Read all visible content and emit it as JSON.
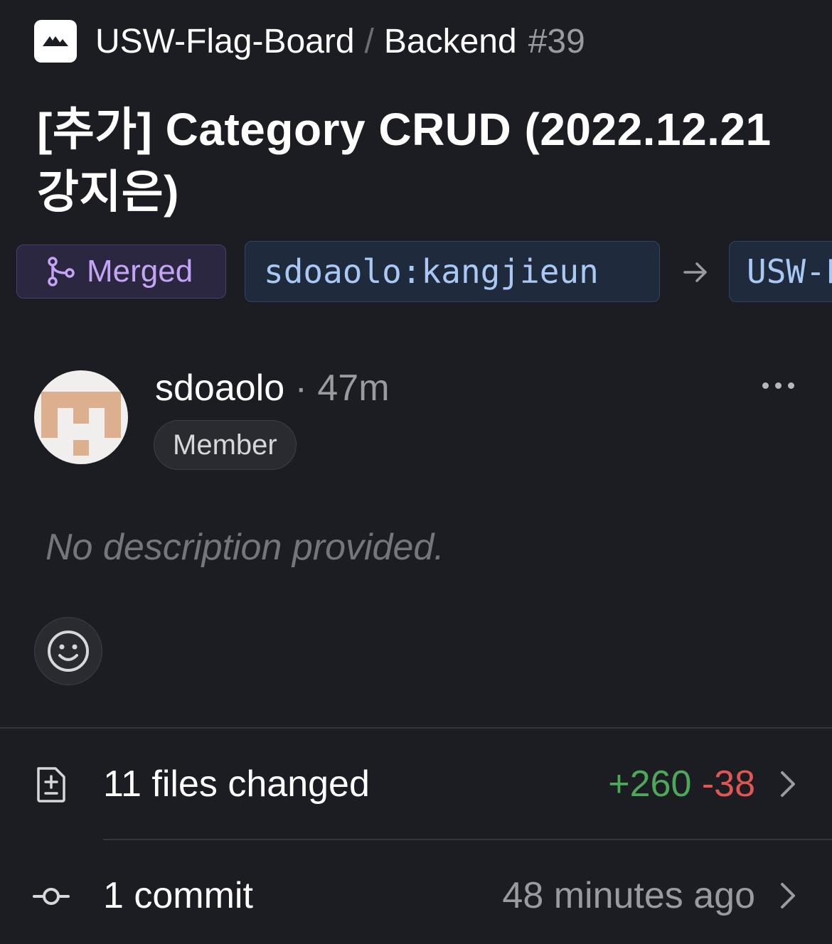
{
  "header": {
    "owner": "USW-Flag-Board",
    "separator": "/",
    "repo": "Backend",
    "number": "#39"
  },
  "pull_request": {
    "title": "[추가] Category CRUD (2022.12.21 강지은)",
    "state": "Merged",
    "head_branch": "sdoaolo:kangjieun",
    "base_branch": "USW-Flag-Board:main"
  },
  "author": {
    "name": "sdoaolo",
    "time": " · 47m",
    "role": "Member"
  },
  "description": "No description provided.",
  "files": {
    "label": "11 files changed",
    "additions": "+260",
    "deletions": "-38"
  },
  "commits": {
    "label": "1 commit",
    "time": "48 minutes ago"
  },
  "colors": {
    "background": "#1c1d22",
    "merged": "#c4a4f5",
    "branch": "#a9c8f4",
    "additions": "#4ea85a",
    "deletions": "#e05652"
  }
}
